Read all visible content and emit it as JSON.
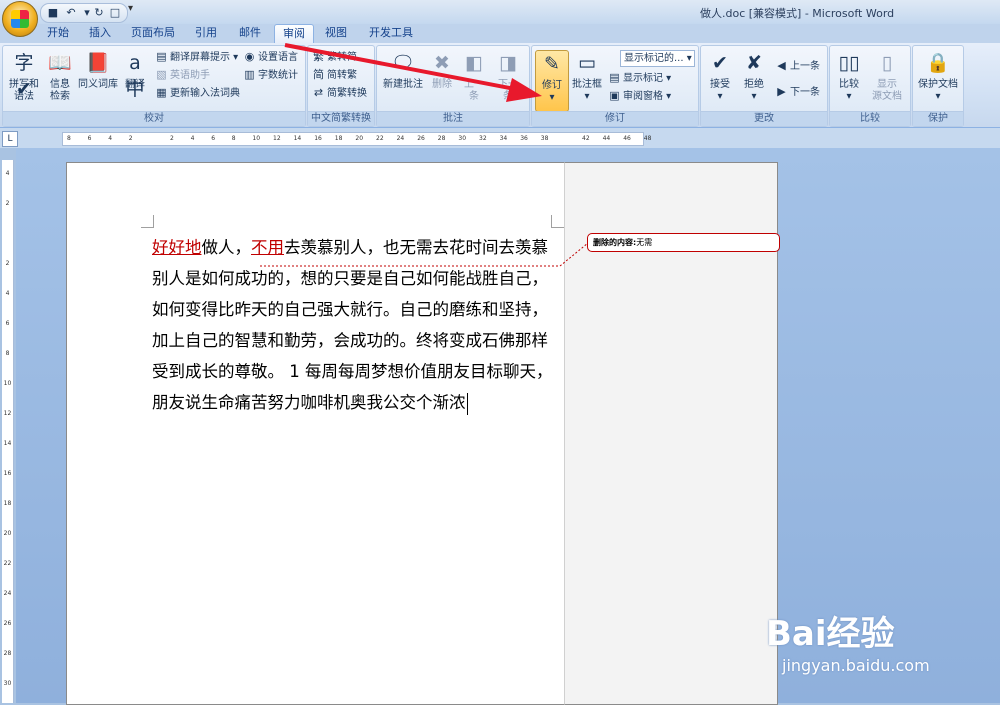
{
  "window": {
    "title": "做人.doc [兼容模式] - Microsoft Word"
  },
  "tabs": [
    {
      "label": "开始"
    },
    {
      "label": "插入"
    },
    {
      "label": "页面布局"
    },
    {
      "label": "引用"
    },
    {
      "label": "邮件"
    },
    {
      "label": "审阅",
      "active": true
    },
    {
      "label": "视图"
    },
    {
      "label": "开发工具"
    }
  ],
  "ribbon": {
    "proofing": {
      "label": "校对",
      "spelling": "拼写和\n语法",
      "research": "信息\n检索",
      "thesaurus": "同义词库",
      "translate": "翻译",
      "screentip": "翻译屏幕提示",
      "english_assistant": "英语助手",
      "update_ime": "更新输入法词典",
      "set_language": "设置语言",
      "word_count": "字数统计"
    },
    "chinese": {
      "label": "中文简繁转换",
      "to_simplified": "繁转简",
      "to_traditional": "简转繁",
      "convert": "简繁转换"
    },
    "comments": {
      "label": "批注",
      "new": "新建批注",
      "delete": "删除",
      "previous": "上一\n条",
      "next": "下一\n条"
    },
    "tracking": {
      "label": "修订",
      "track_changes": "修订",
      "balloons": "批注框",
      "display_select": "显示标记的...",
      "show_markup": "显示标记",
      "reviewing_pane": "审阅窗格"
    },
    "changes": {
      "label": "更改",
      "accept": "接受",
      "reject": "拒绝",
      "previous": "上一条",
      "next": "下一条"
    },
    "compare": {
      "label": "比较",
      "compare": "比较",
      "show_source": "显示\n源文档"
    },
    "protect": {
      "label": "保护",
      "protect_doc": "保护文档"
    }
  },
  "ruler": {
    "h_ticks": [
      "8",
      "6",
      "4",
      "2",
      "",
      "2",
      "4",
      "6",
      "8",
      "10",
      "12",
      "14",
      "16",
      "18",
      "20",
      "22",
      "24",
      "26",
      "28",
      "30",
      "32",
      "34",
      "36",
      "38",
      "",
      "42",
      "44",
      "46",
      "48"
    ],
    "v_ticks": [
      "4",
      "2",
      "",
      "2",
      "4",
      "6",
      "8",
      "10",
      "12",
      "14",
      "16",
      "18",
      "20",
      "22",
      "24",
      "26",
      "28",
      "30"
    ]
  },
  "document": {
    "inserted_1": "好好地",
    "text_1": "做人，",
    "inserted_2": "不用",
    "text_2": "去羡慕别人，也无需去花时间去羡慕别人是如何成功的，想的只要是自己如何能战胜自己，如何变得比昨天的自己强大就行。自己的磨练和坚持，加上自己的智慧和勤劳，会成功的。终将变成石佛那样受到成长的尊敬。 1 每周每周梦想价值朋友目标聊天，朋友说生命痛苦努力咖啡机奥我公交个渐浓"
  },
  "balloon": {
    "label": "删除的内容:",
    "content": "无需"
  },
  "watermark": {
    "brand": "Bai经验",
    "url": "jingyan.baidu.com"
  },
  "colors": {
    "revision": "#c00000",
    "ribbon_bg": "#dbe7f5",
    "doc_bg": "#a4c2e7",
    "arrow": "#e8192c"
  }
}
